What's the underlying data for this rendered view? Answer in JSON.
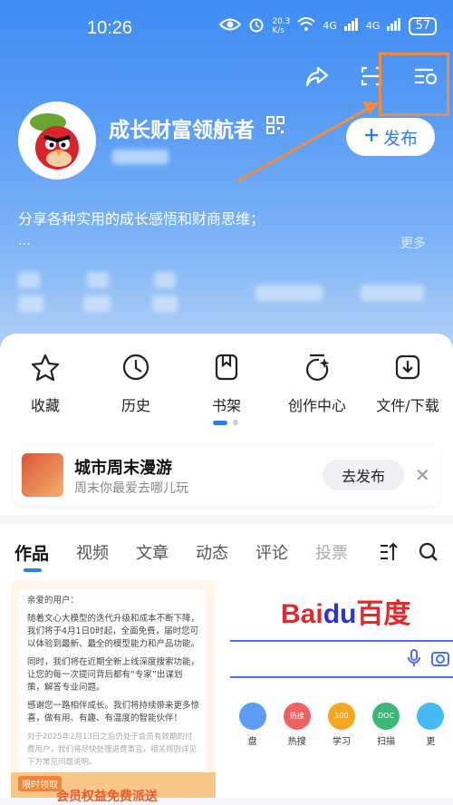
{
  "status_bar": {
    "time": "10:26",
    "network_speed": "20.3\nK/s",
    "signal_4g_a": "4G",
    "signal_4g_b": "4G",
    "battery": "57"
  },
  "profile": {
    "name": "成长财富领航者",
    "publish_label": "发布",
    "bio": "分享各种实用的成长感悟和财商思维；",
    "bio_dots": "…",
    "bio_more": "更多"
  },
  "quick_actions": [
    {
      "label": "收藏",
      "icon": "star-icon"
    },
    {
      "label": "历史",
      "icon": "clock-icon"
    },
    {
      "label": "书架",
      "icon": "bookmark-icon"
    },
    {
      "label": "创作中心",
      "icon": "sparkle-icon"
    },
    {
      "label": "文件/下载",
      "icon": "download-icon"
    }
  ],
  "banner": {
    "title": "城市周末漫游",
    "subtitle": "周末你最爱去哪儿玩",
    "button": "去发布"
  },
  "tabs": [
    "作品",
    "视频",
    "文章",
    "动态",
    "评论",
    "投票"
  ],
  "active_tab": "作品",
  "notice": {
    "greeting": "亲爱的用户：",
    "p1": "随着文心大模型的迭代升级和成本不断下降，我们将于4月1日0时起，全面免费，届时您可以体验到最新、最全的模型能力和产品功能。",
    "p2": "同时，我们将在近期全新上线深度搜索功能，让您的每一次提问背后都有“专家”出谋划策，解答专业问题。",
    "p3": "感谢您一路相伴成长。我们将持续带来更多惊喜，做有用、有趣、有温度的智能伙伴！",
    "p4": "对于2025年2月13日之后仍处于会员有效期的付费用户，我们将尽快处理退费事宜，相关规则详见下方常见问题说明。",
    "badge": "限时领取",
    "bottom": "会员权益免费派送"
  },
  "baidu": {
    "logo_bai": "Bai",
    "logo_du": "du",
    "logo_cn": "百度",
    "shortcuts": [
      "盘",
      "热搜",
      "学习",
      "扫描",
      "更"
    ],
    "shortcut_badges": [
      "",
      "热搜",
      "100",
      "DOC",
      ""
    ]
  },
  "colors": {
    "accent": "#2d7df0",
    "highlight": "#f08c3c",
    "baidu_red": "#e1292b",
    "baidu_blue": "#2932e1"
  }
}
